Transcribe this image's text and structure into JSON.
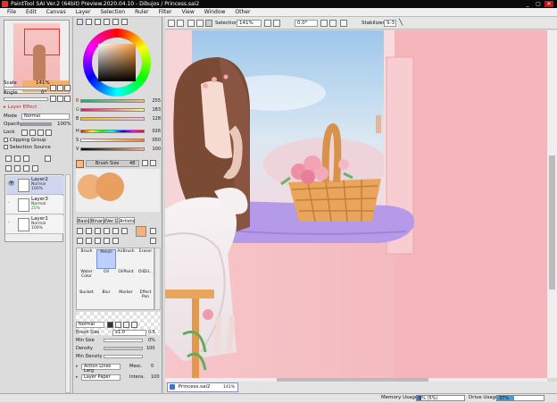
{
  "window": {
    "title": "PaintTool SAI Ver.2 (64bit) Preview.2020.04.10 - Dibujos / Princess.sai2",
    "minimize": "_",
    "maximize": "▢",
    "close": "✕"
  },
  "menu": [
    "File",
    "Edit",
    "Canvas",
    "Layer",
    "Selection",
    "Ruler",
    "Filter",
    "View",
    "Window",
    "Other"
  ],
  "toolbar": {
    "selection_label": "Selection",
    "zoom": "141%",
    "angle": "0.0°",
    "stabilizer_label": "Stabilizer",
    "stabilizer_value": "S-3"
  },
  "navigator": {
    "scale_label": "Scale",
    "scale_value": "141%",
    "angle_label": "Angle",
    "angle_value": "0°"
  },
  "layer_effect": {
    "title": "Layer Effect"
  },
  "layer_props": {
    "mode_label": "Mode",
    "mode_value": "Normal",
    "opacity_label": "Opacity",
    "opacity_value": "100%",
    "lock_label": "Lock",
    "clipping_label": "Clipping Group",
    "selection_source_label": "Selection Source"
  },
  "layers": [
    {
      "name": "Layer2",
      "blend": "Normal",
      "opacity": "100%",
      "active": true
    },
    {
      "name": "Layer3",
      "blend": "Normal",
      "opacity": "25%",
      "active": false
    },
    {
      "name": "Layer1",
      "blend": "Normal",
      "opacity": "100%",
      "active": false
    }
  ],
  "color": {
    "r_label": "R",
    "r": "255",
    "g_label": "G",
    "g": "183",
    "b_label": "B",
    "b": "128",
    "h_label": "H",
    "h": "026",
    "s_label": "S",
    "s": "050",
    "v_label": "V",
    "v": "100",
    "current": "#ffb780"
  },
  "brush": {
    "size_label": "Brush Size",
    "size_value": "48",
    "tabs": [
      "Basic",
      "Binary",
      "Ver.1",
      "Artistic"
    ],
    "tools": [
      {
        "name": "Brush"
      },
      {
        "name": "Pencil"
      },
      {
        "name": "AirBrush"
      },
      {
        "name": "Eraser"
      },
      {
        "name": "Water Color"
      },
      {
        "name": "Oil"
      },
      {
        "name": "OilPaint"
      },
      {
        "name": "OilDil..."
      },
      {
        "name": "Bucket"
      },
      {
        "name": "Blur"
      },
      {
        "name": "Marker"
      },
      {
        "name": "Effect Pen"
      }
    ],
    "blend_mode": "Normal",
    "brush_size_label": "Brush Size",
    "brush_size_mult": "x1.0",
    "brush_size_value": "0.5",
    "min_size_label": "Min Size",
    "min_size_value": "0%",
    "density_label": "Density",
    "density_value": "100",
    "min_density_label": "Min Density"
  },
  "presets": [
    {
      "name": "Action Lines Larg",
      "extra": "Mesc.",
      "num": "0"
    },
    {
      "name": "Layer Paper",
      "extra": "Intens.",
      "num": "100"
    }
  ],
  "file_tab": {
    "name": "Princess.sai2",
    "zoom": "141%"
  },
  "status": {
    "memory_label": "Memory Usage",
    "memory_value": "9% (5%)",
    "drive_label": "Drive Usage",
    "drive_value": "37%",
    "memory_fraction": 0.09,
    "drive_fraction": 0.37
  }
}
